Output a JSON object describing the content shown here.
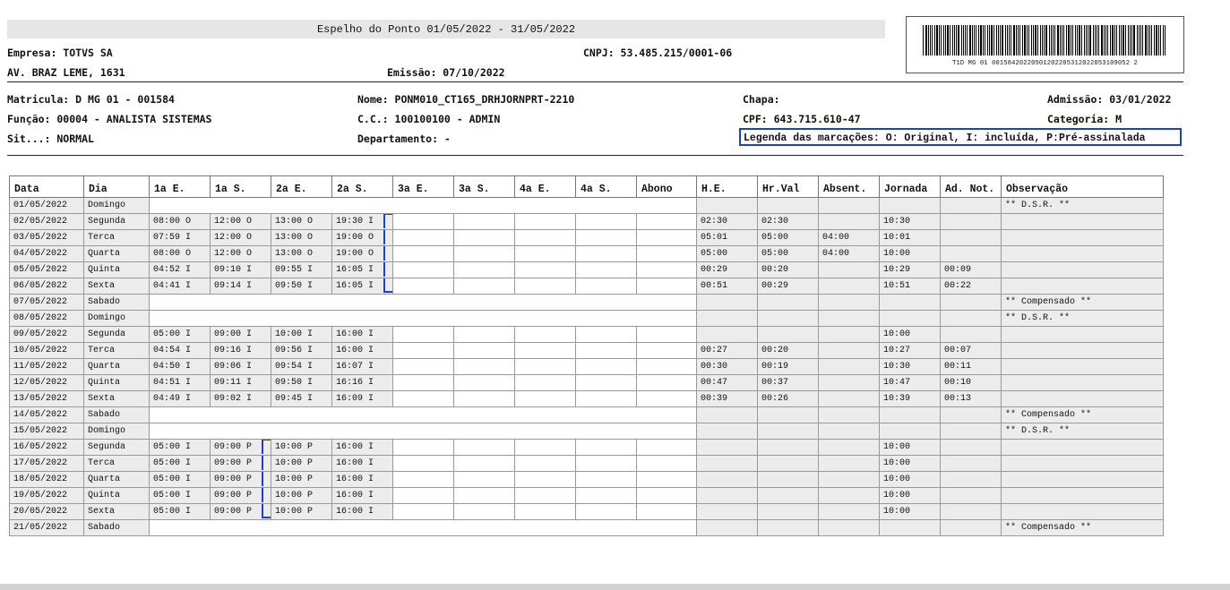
{
  "report": {
    "title": "Espelho do Ponto 01/05/2022 - 31/05/2022",
    "empresa": "Empresa: TOTVS SA",
    "cnpj": "CNPJ: 53.485.215/0001-06",
    "endereco": "AV. BRAZ LEME, 1631",
    "emissao": "Emissão: 07/10/2022",
    "barcode_text": "T1D MG 01 00158420220501202205312022053109052 2"
  },
  "employee": {
    "matricula": "Matricula: D MG 01 - 001584",
    "nome": "Nome: PONM010_CT165_DRHJORNPRT-2210",
    "chapa": "Chapa:",
    "admissao": "Admissão: 03/01/2022",
    "funcao": "Função: 00004 - ANALISTA SISTEMAS",
    "cc": "C.C.: 100100100 - ADMIN",
    "cpf": "CPF: 643.715.610-47",
    "categoria": "Categoria: M",
    "situacao": "Sit...: NORMAL",
    "departamento": "Departamento:  -",
    "legenda": "Legenda das marcações: O: Original, I: incluída, P:Pré-assinalada"
  },
  "table": {
    "headers": [
      "Data",
      "Dia",
      "1a E.",
      "1a S.",
      "2a E.",
      "2a S.",
      "3a E.",
      "3a S.",
      "4a E.",
      "4a S.",
      "Abono",
      "H.E.",
      "Hr.Val",
      "Absent.",
      "Jornada",
      "Ad. Not.",
      "Observação"
    ],
    "rows": [
      {
        "data": "01/05/2022",
        "dia": "Domingo",
        "e1": "",
        "s1": "",
        "e2": "",
        "s2": "",
        "he": "",
        "hrval": "",
        "absent": "",
        "jornada": "",
        "adnot": "",
        "obs": "** D.S.R. **",
        "off": true
      },
      {
        "data": "02/05/2022",
        "dia": "Segunda",
        "e1": "08:00 O",
        "s1": "12:00 O",
        "e2": "13:00 O",
        "s2": "19:30 I",
        "he": "02:30",
        "hrval": "02:30",
        "absent": "",
        "jornada": "10:30",
        "adnot": "",
        "obs": ""
      },
      {
        "data": "03/05/2022",
        "dia": "Terca",
        "e1": "07:59 I",
        "s1": "12:00 O",
        "e2": "13:00 O",
        "s2": "19:00 O",
        "he": "05:01",
        "hrval": "05:00",
        "absent": "04:00",
        "jornada": "10:01",
        "adnot": "",
        "obs": ""
      },
      {
        "data": "04/05/2022",
        "dia": "Quarta",
        "e1": "08:00 O",
        "s1": "12:00 O",
        "e2": "13:00 O",
        "s2": "19:00 O",
        "he": "05:00",
        "hrval": "05:00",
        "absent": "04:00",
        "jornada": "10:00",
        "adnot": "",
        "obs": ""
      },
      {
        "data": "05/05/2022",
        "dia": "Quinta",
        "e1": "04:52 I",
        "s1": "09:10 I",
        "e2": "09:55 I",
        "s2": "16:05 I",
        "he": "00:29",
        "hrval": "00:20",
        "absent": "",
        "jornada": "10:29",
        "adnot": "00:09",
        "obs": ""
      },
      {
        "data": "06/05/2022",
        "dia": "Sexta",
        "e1": "04:41 I",
        "s1": "09:14 I",
        "e2": "09:50 I",
        "s2": "16:05 I",
        "he": "00:51",
        "hrval": "00:29",
        "absent": "",
        "jornada": "10:51",
        "adnot": "00:22",
        "obs": ""
      },
      {
        "data": "07/05/2022",
        "dia": "Sabado",
        "e1": "",
        "s1": "",
        "e2": "",
        "s2": "",
        "he": "",
        "hrval": "",
        "absent": "",
        "jornada": "",
        "adnot": "",
        "obs": "** Compensado **",
        "off": true
      },
      {
        "data": "08/05/2022",
        "dia": "Domingo",
        "e1": "",
        "s1": "",
        "e2": "",
        "s2": "",
        "he": "",
        "hrval": "",
        "absent": "",
        "jornada": "",
        "adnot": "",
        "obs": "** D.S.R. **",
        "off": true
      },
      {
        "data": "09/05/2022",
        "dia": "Segunda",
        "e1": "05:00 I",
        "s1": "09:00 I",
        "e2": "10:00 I",
        "s2": "16:00 I",
        "he": "",
        "hrval": "",
        "absent": "",
        "jornada": "10:00",
        "adnot": "",
        "obs": ""
      },
      {
        "data": "10/05/2022",
        "dia": "Terca",
        "e1": "04:54 I",
        "s1": "09:16 I",
        "e2": "09:56 I",
        "s2": "16:00 I",
        "he": "00:27",
        "hrval": "00:20",
        "absent": "",
        "jornada": "10:27",
        "adnot": "00:07",
        "obs": ""
      },
      {
        "data": "11/05/2022",
        "dia": "Quarta",
        "e1": "04:50 I",
        "s1": "09:06 I",
        "e2": "09:54 I",
        "s2": "16:07 I",
        "he": "00:30",
        "hrval": "00:19",
        "absent": "",
        "jornada": "10:30",
        "adnot": "00:11",
        "obs": ""
      },
      {
        "data": "12/05/2022",
        "dia": "Quinta",
        "e1": "04:51 I",
        "s1": "09:11 I",
        "e2": "09:50 I",
        "s2": "16:16 I",
        "he": "00:47",
        "hrval": "00:37",
        "absent": "",
        "jornada": "10:47",
        "adnot": "00:10",
        "obs": ""
      },
      {
        "data": "13/05/2022",
        "dia": "Sexta",
        "e1": "04:49 I",
        "s1": "09:02 I",
        "e2": "09:45 I",
        "s2": "16:09 I",
        "he": "00:39",
        "hrval": "00:26",
        "absent": "",
        "jornada": "10:39",
        "adnot": "00:13",
        "obs": ""
      },
      {
        "data": "14/05/2022",
        "dia": "Sabado",
        "e1": "",
        "s1": "",
        "e2": "",
        "s2": "",
        "he": "",
        "hrval": "",
        "absent": "",
        "jornada": "",
        "adnot": "",
        "obs": "** Compensado **",
        "off": true
      },
      {
        "data": "15/05/2022",
        "dia": "Domingo",
        "e1": "",
        "s1": "",
        "e2": "",
        "s2": "",
        "he": "",
        "hrval": "",
        "absent": "",
        "jornada": "",
        "adnot": "",
        "obs": "** D.S.R. **",
        "off": true
      },
      {
        "data": "16/05/2022",
        "dia": "Segunda",
        "e1": "05:00 I",
        "s1": "09:00 P",
        "e2": "10:00 P",
        "s2": "16:00 I",
        "he": "",
        "hrval": "",
        "absent": "",
        "jornada": "10:00",
        "adnot": "",
        "obs": ""
      },
      {
        "data": "17/05/2022",
        "dia": "Terca",
        "e1": "05:00 I",
        "s1": "09:00 P",
        "e2": "10:00 P",
        "s2": "16:00 I",
        "he": "",
        "hrval": "",
        "absent": "",
        "jornada": "10:00",
        "adnot": "",
        "obs": ""
      },
      {
        "data": "18/05/2022",
        "dia": "Quarta",
        "e1": "05:00 I",
        "s1": "09:00 P",
        "e2": "10:00 P",
        "s2": "16:00 I",
        "he": "",
        "hrval": "",
        "absent": "",
        "jornada": "10:00",
        "adnot": "",
        "obs": ""
      },
      {
        "data": "19/05/2022",
        "dia": "Quinta",
        "e1": "05:00 I",
        "s1": "09:00 P",
        "e2": "10:00 P",
        "s2": "16:00 I",
        "he": "",
        "hrval": "",
        "absent": "",
        "jornada": "10:00",
        "adnot": "",
        "obs": ""
      },
      {
        "data": "20/05/2022",
        "dia": "Sexta",
        "e1": "05:00 I",
        "s1": "09:00 P",
        "e2": "10:00 P",
        "s2": "16:00 I",
        "he": "",
        "hrval": "",
        "absent": "",
        "jornada": "10:00",
        "adnot": "",
        "obs": ""
      },
      {
        "data": "21/05/2022",
        "dia": "Sabado",
        "e1": "",
        "s1": "",
        "e2": "",
        "s2": "",
        "he": "",
        "hrval": "",
        "absent": "",
        "jornada": "",
        "adnot": "",
        "obs": "** Compensado **",
        "off": true
      }
    ]
  },
  "colors": {
    "highlight": "#1b3fcf",
    "header_bg": "#e6e6e6",
    "cell_bg": "#ececec"
  }
}
